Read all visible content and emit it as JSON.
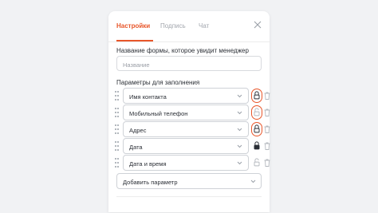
{
  "tabs": [
    {
      "label": "Настройки",
      "active": true
    },
    {
      "label": "Подпись",
      "active": false
    },
    {
      "label": "Чат",
      "active": false
    }
  ],
  "icons": {
    "close": "close-icon",
    "drag": "drag-handle-icon",
    "lock": "lock-icon",
    "trash": "trash-icon",
    "chevron": "chevron-down-icon"
  },
  "colors": {
    "accent": "#e8562a",
    "text": "#2b2f36",
    "muted": "#a2a6ad",
    "border": "#cfd2d7",
    "background": "#f1f2f4"
  },
  "form": {
    "name_label": "Название формы, которое увидит менеджер",
    "name_placeholder": "Название",
    "params_label": "Параметры для заполнения",
    "params": [
      {
        "label": "Имя контакта",
        "lock": "locked",
        "highlighted": true
      },
      {
        "label": "Мобильный телефон",
        "lock": "unlocked",
        "highlighted": true
      },
      {
        "label": "Адрес",
        "lock": "locked",
        "highlighted": true
      },
      {
        "label": "Дата",
        "lock": "locked",
        "highlighted": false
      },
      {
        "label": "Дата и время",
        "lock": "unlocked",
        "highlighted": false
      }
    ],
    "add_param_label": "Добавить параметр"
  }
}
